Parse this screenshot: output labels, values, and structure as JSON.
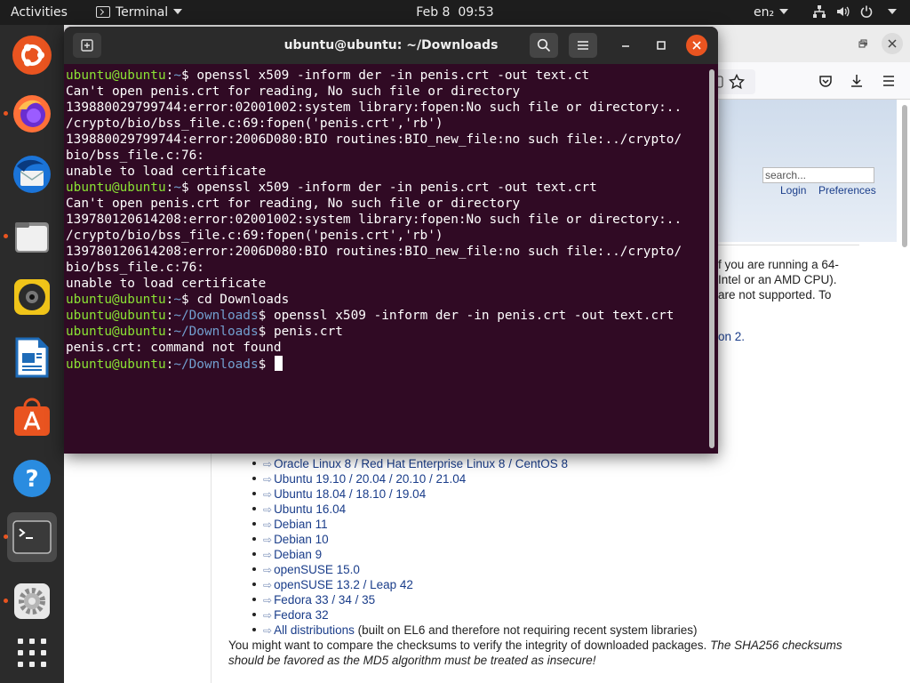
{
  "topbar": {
    "activities": "Activities",
    "app_name": "Terminal",
    "clock": "Feb 8  09:53",
    "language": "en₂"
  },
  "dock": {
    "items": [
      {
        "name": "ubuntu-logo",
        "running": false
      },
      {
        "name": "firefox",
        "running": true
      },
      {
        "name": "thunderbird",
        "running": false
      },
      {
        "name": "files",
        "running": true
      },
      {
        "name": "rhythmbox",
        "running": false
      },
      {
        "name": "libreoffice-writer",
        "running": false
      },
      {
        "name": "ubuntu-software",
        "running": false
      },
      {
        "name": "help",
        "running": false
      },
      {
        "name": "terminal",
        "running": true,
        "active": true
      },
      {
        "name": "settings",
        "running": true
      },
      {
        "name": "show-applications",
        "running": false
      }
    ]
  },
  "terminal": {
    "title": "ubuntu@ubuntu: ~/Downloads",
    "prompt_user": "ubuntu@ubuntu",
    "lines": [
      {
        "type": "prompt",
        "path": "~",
        "cmd": "openssl x509 -inform der -in penis.crt -out text.ct"
      },
      {
        "type": "out",
        "text": "Can't open penis.crt for reading, No such file or directory"
      },
      {
        "type": "out",
        "text": "139880029799744:error:02001002:system library:fopen:No such file or directory:.."
      },
      {
        "type": "out",
        "text": "/crypto/bio/bss_file.c:69:fopen('penis.crt','rb')"
      },
      {
        "type": "out",
        "text": "139880029799744:error:2006D080:BIO routines:BIO_new_file:no such file:../crypto/"
      },
      {
        "type": "out",
        "text": "bio/bss_file.c:76:"
      },
      {
        "type": "out",
        "text": "unable to load certificate"
      },
      {
        "type": "prompt",
        "path": "~",
        "cmd": "openssl x509 -inform der -in penis.crt -out text.crt"
      },
      {
        "type": "out",
        "text": "Can't open penis.crt for reading, No such file or directory"
      },
      {
        "type": "out",
        "text": "139780120614208:error:02001002:system library:fopen:No such file or directory:.."
      },
      {
        "type": "out",
        "text": "/crypto/bio/bss_file.c:69:fopen('penis.crt','rb')"
      },
      {
        "type": "out",
        "text": "139780120614208:error:2006D080:BIO routines:BIO_new_file:no such file:../crypto/"
      },
      {
        "type": "out",
        "text": "bio/bss_file.c:76:"
      },
      {
        "type": "out",
        "text": "unable to load certificate"
      },
      {
        "type": "prompt",
        "path": "~",
        "cmd": "cd Downloads"
      },
      {
        "type": "prompt",
        "path": "~/Downloads",
        "cmd": "openssl x509 -inform der -in penis.crt -out text.crt"
      },
      {
        "type": "prompt",
        "path": "~/Downloads",
        "cmd": "penis.crt"
      },
      {
        "type": "out",
        "text": "penis.crt: command not found"
      },
      {
        "type": "prompt",
        "path": "~/Downloads",
        "cmd": "",
        "cursor": true
      }
    ]
  },
  "browser": {
    "search_placeholder": "search...",
    "login": "Login",
    "preferences": "Preferences",
    "intro_fragments": [
      "f you are running a 64-",
      "Intel or an AMD CPU).",
      "are not supported. To",
      "on 2."
    ],
    "distributions": [
      "Oracle Linux 8 / Red Hat Enterprise Linux 8 / CentOS 8",
      "Ubuntu 19.10 / 20.04 / 20.10 / 21.04",
      "Ubuntu 18.04 / 18.10 / 19.04",
      "Ubuntu 16.04",
      "Debian 11",
      "Debian 10",
      "Debian 9",
      "openSUSE 15.0",
      "openSUSE 13.2 / Leap 42",
      "Fedora 33 / 34 / 35",
      "Fedora 32",
      "All distributions"
    ],
    "all_distributions_note": " (built on EL6 and therefore not requiring recent system libraries)",
    "checksum_text": "You might want to compare the checksums to verify the integrity of downloaded packages. ",
    "checksum_italic": "The SHA256 checksums should be favored as the MD5 algorithm must be treated as insecure!"
  },
  "colors": {
    "terminal_bg": "#300a24",
    "prompt_user": "#8ae234",
    "prompt_path": "#729fcf",
    "accent": "#e95420"
  }
}
